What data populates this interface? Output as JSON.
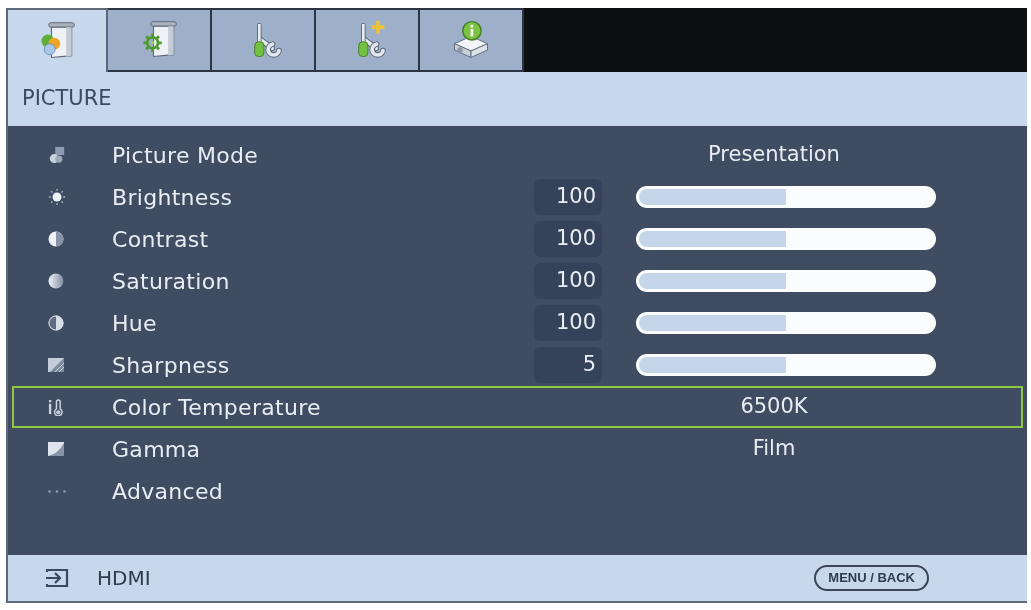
{
  "tabs": [
    {
      "selected": true
    },
    {
      "selected": false
    },
    {
      "selected": false
    },
    {
      "selected": false
    },
    {
      "selected": false
    }
  ],
  "section": {
    "title": "PICTURE"
  },
  "settings": [
    {
      "kind": "option",
      "label": "Picture Mode",
      "value": "Presentation",
      "selected": false
    },
    {
      "kind": "slider",
      "label": "Brightness",
      "value": "100",
      "level": 0.5,
      "selected": false
    },
    {
      "kind": "slider",
      "label": "Contrast",
      "value": "100",
      "level": 0.5,
      "selected": false
    },
    {
      "kind": "slider",
      "label": "Saturation",
      "value": "100",
      "level": 0.5,
      "selected": false
    },
    {
      "kind": "slider",
      "label": "Hue",
      "value": "100",
      "level": 0.5,
      "selected": false
    },
    {
      "kind": "slider",
      "label": "Sharpness",
      "value": "5",
      "level": 0.5,
      "selected": false
    },
    {
      "kind": "option",
      "label": "Color Temperature",
      "value": "6500K",
      "selected": true
    },
    {
      "kind": "option",
      "label": "Gamma",
      "value": "Film",
      "selected": false
    },
    {
      "kind": "submenu",
      "label": "Advanced",
      "selected": false
    }
  ],
  "status_bar": {
    "source": "HDMI",
    "hint": "MENU / BACK"
  }
}
